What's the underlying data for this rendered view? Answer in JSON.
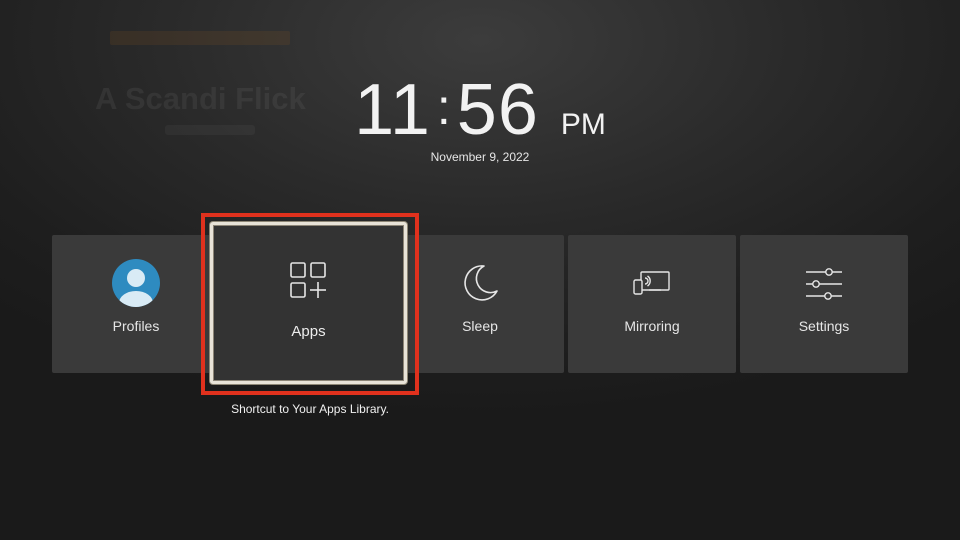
{
  "background_promo": {
    "title": "A Scandi Flick"
  },
  "clock": {
    "hours": "11",
    "minutes": "56",
    "ampm": "PM"
  },
  "date": "November 9, 2022",
  "tiles": [
    {
      "label": "Profiles",
      "icon": "profile-avatar-icon"
    },
    {
      "label": "Apps",
      "icon": "apps-grid-icon",
      "selected": true
    },
    {
      "label": "Sleep",
      "icon": "moon-icon"
    },
    {
      "label": "Mirroring",
      "icon": "screen-mirroring-icon"
    },
    {
      "label": "Settings",
      "icon": "sliders-icon"
    }
  ],
  "caption": "Shortcut to Your Apps Library.",
  "colors": {
    "background": "#1c1c1c",
    "tile": "#3a3a3a",
    "highlight": "#e0311d",
    "focus_border": "#e8e3d8",
    "avatar": "#2e8bc0"
  }
}
